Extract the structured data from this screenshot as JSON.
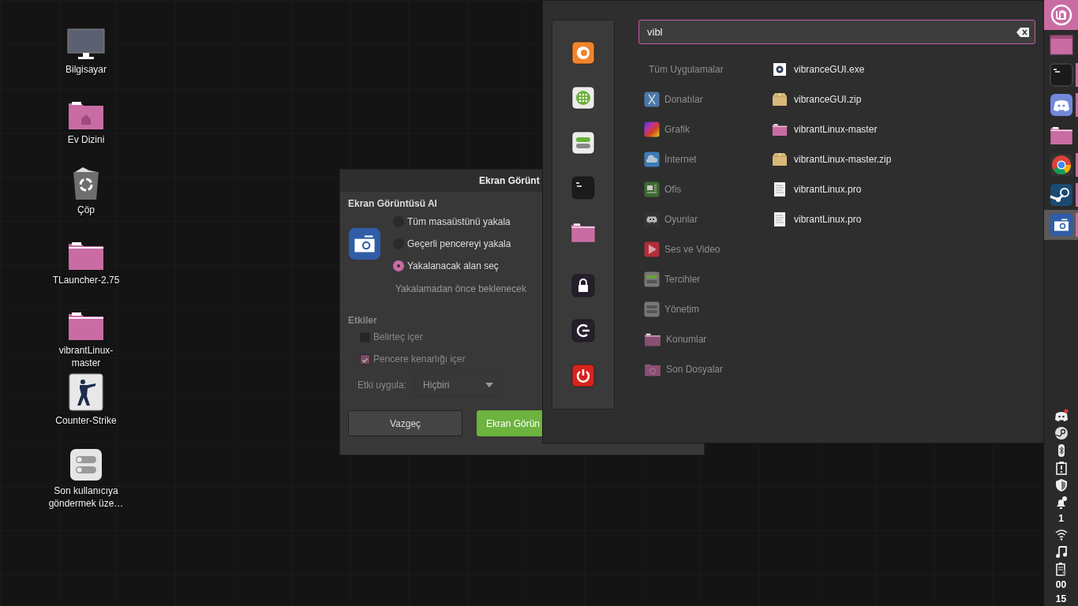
{
  "desktop_icons": [
    {
      "kind": "computer",
      "label": "Bilgisayar"
    },
    {
      "kind": "home",
      "label": "Ev Dizini"
    },
    {
      "kind": "trash",
      "label": "Çöp"
    },
    {
      "kind": "folder",
      "label": "TLauncher-2.75"
    },
    {
      "kind": "folder",
      "label": "vibrantLinux-master"
    },
    {
      "kind": "game",
      "label": "Counter-Strike"
    },
    {
      "kind": "settings",
      "label": "Son kullanıcıya göndermek üze…"
    }
  ],
  "dialog": {
    "title": "Ekran Görünt",
    "heading": "Ekran Görüntüsü Al",
    "options": [
      {
        "label": "Tüm masaüstünü yakala",
        "selected": false
      },
      {
        "label": "Geçerli pencereyi yakala",
        "selected": false
      },
      {
        "label": "Yakalanacak alan seç",
        "selected": true
      }
    ],
    "delay_label": "Yakalamadan önce beklenecek",
    "effects_heading": "Etkiler",
    "checks": [
      {
        "label": "Belirteç içer",
        "checked": false
      },
      {
        "label": "Pencere kenarlığı içer",
        "checked": true
      }
    ],
    "effect_label": "Etki uygula:",
    "effect_value": "Hiçbiri",
    "cancel": "Vazgeç",
    "confirm": "Ekran Görün"
  },
  "menu": {
    "favorites": [
      {
        "kind": "browser"
      },
      {
        "kind": "apps"
      },
      {
        "kind": "toggles"
      },
      {
        "kind": "terminal"
      },
      {
        "kind": "folder"
      },
      {
        "kind": "lock"
      },
      {
        "kind": "logout"
      },
      {
        "kind": "power"
      }
    ],
    "search": {
      "value": "vibl"
    },
    "categories": [
      {
        "kind": "all",
        "label": "Tüm Uygulamalar"
      },
      {
        "kind": "accessories",
        "label": "Donatılar"
      },
      {
        "kind": "graphics",
        "label": "Grafik"
      },
      {
        "kind": "internet",
        "label": "İnternet"
      },
      {
        "kind": "office",
        "label": "Ofis"
      },
      {
        "kind": "games",
        "label": "Oyunlar"
      },
      {
        "kind": "media",
        "label": "Ses ve Video"
      },
      {
        "kind": "preferences",
        "label": "Tercihler"
      },
      {
        "kind": "admin",
        "label": "Yönetim"
      },
      {
        "kind": "places",
        "label": "Konumlar"
      },
      {
        "kind": "recent",
        "label": "Son Dosyalar"
      }
    ],
    "results": [
      {
        "kind": "exe",
        "label": "vibranceGUI.exe"
      },
      {
        "kind": "zip",
        "label": "vibranceGUI.zip"
      },
      {
        "kind": "folder",
        "label": "vibrantLinux-master"
      },
      {
        "kind": "zip",
        "label": "vibrantLinux-master.zip"
      },
      {
        "kind": "text",
        "label": "vibrantLinux.pro"
      },
      {
        "kind": "text",
        "label": "vibrantLinux.pro"
      }
    ]
  },
  "panel": {
    "launchers": [
      {
        "kind": "window",
        "running": false,
        "selected": false
      },
      {
        "kind": "terminal",
        "running": true,
        "selected": false
      },
      {
        "kind": "chat",
        "running": true,
        "selected": false
      },
      {
        "kind": "folder",
        "running": false,
        "selected": false
      },
      {
        "kind": "chrome",
        "running": true,
        "selected": false
      },
      {
        "kind": "steam",
        "running": true,
        "selected": false
      },
      {
        "kind": "camera",
        "running": true,
        "selected": true
      }
    ],
    "tray": [
      {
        "kind": "chat"
      },
      {
        "kind": "steam"
      },
      {
        "kind": "bluetooth"
      },
      {
        "kind": "clipboard"
      },
      {
        "kind": "shield"
      },
      {
        "kind": "bell"
      },
      {
        "kind": "count",
        "text": "1"
      },
      {
        "kind": "wifi"
      },
      {
        "kind": "music"
      },
      {
        "kind": "battery"
      },
      {
        "kind": "clock",
        "text": "00"
      },
      {
        "kind": "clock",
        "text": "15"
      }
    ]
  }
}
